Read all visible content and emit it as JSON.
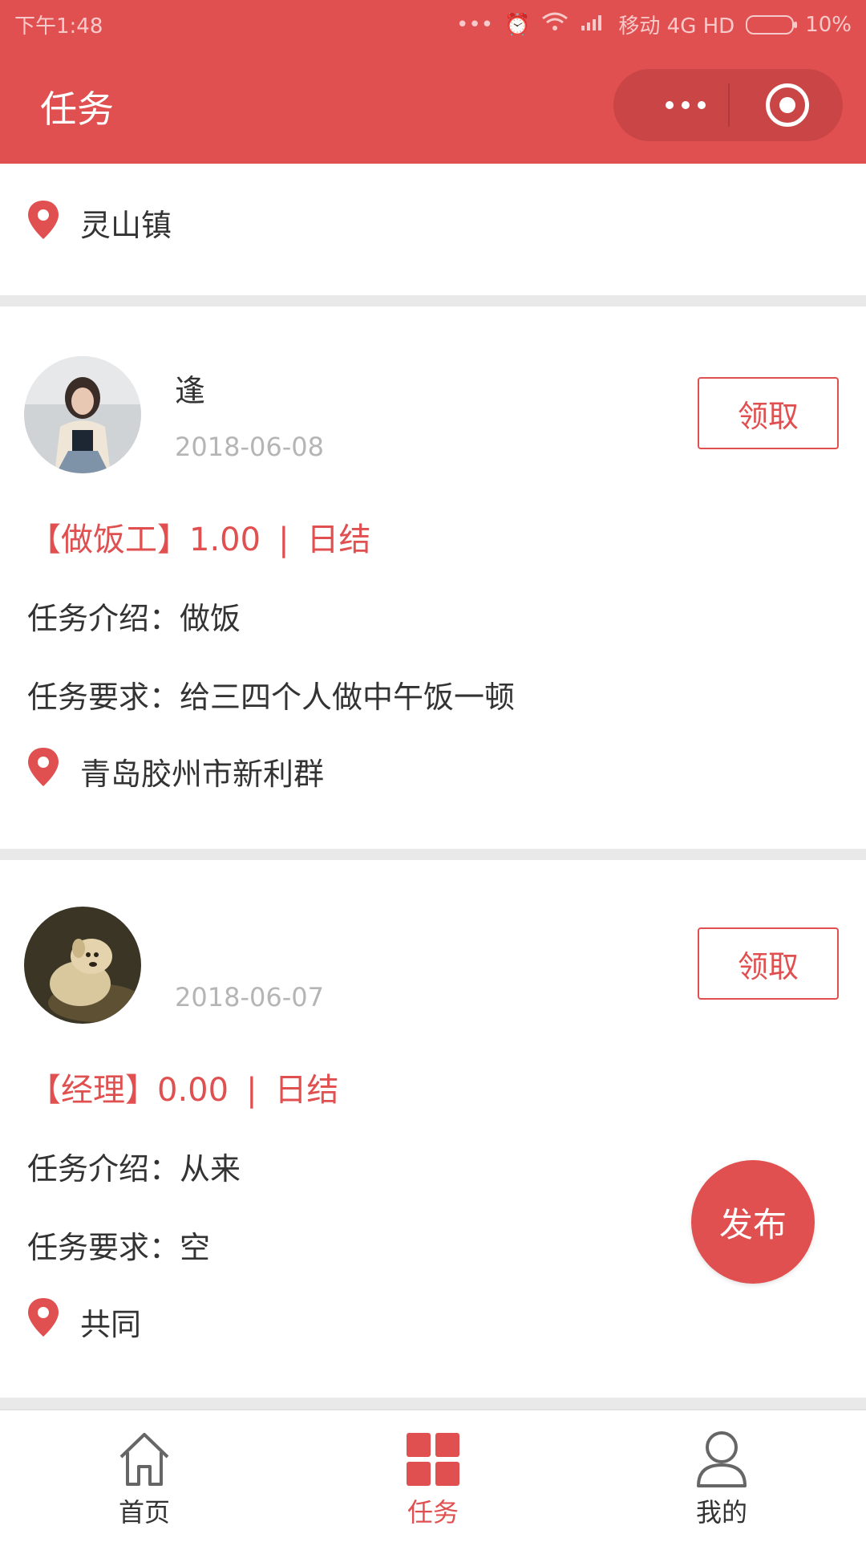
{
  "status_bar": {
    "time": "下午1:48",
    "carrier": "移动 4G HD",
    "battery": "10%"
  },
  "nav": {
    "title": "任务"
  },
  "location": {
    "name": "灵山镇"
  },
  "colors": {
    "brand": "#e05050",
    "muted": "#b5b5b5",
    "divider": "#e9e9e9"
  },
  "tasks": [
    {
      "user": "逢",
      "date": "2018-06-08",
      "claim_label": "领取",
      "title": "【做饭工】",
      "pay": "1.00",
      "separator": "|",
      "settle": "日结",
      "intro_label": "任务介绍：",
      "intro": "做饭",
      "req_label": "任务要求：",
      "req": "给三四个人做中午饭一顿",
      "place": "青岛胶州市新利群"
    },
    {
      "user": "",
      "date": "2018-06-07",
      "claim_label": "领取",
      "title": "【经理】",
      "pay": "0.00",
      "separator": "|",
      "settle": "日结",
      "intro_label": "任务介绍：",
      "intro": "从来",
      "req_label": "任务要求：",
      "req": "空",
      "place": "共同"
    }
  ],
  "fab": {
    "label": "发布"
  },
  "tabbar": {
    "items": [
      {
        "label": "首页",
        "icon": "home-icon"
      },
      {
        "label": "任务",
        "icon": "grid-icon"
      },
      {
        "label": "我的",
        "icon": "person-icon"
      }
    ],
    "active": 1
  }
}
